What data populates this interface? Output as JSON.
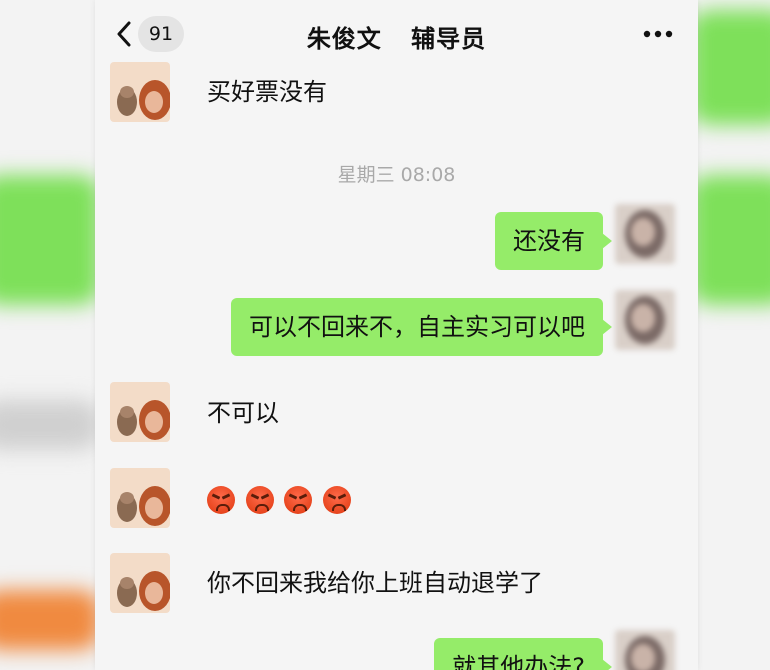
{
  "header": {
    "back_badge": "91",
    "title_name": "朱俊文",
    "title_role": "辅导员"
  },
  "messages": {
    "m1": "买好票没有",
    "timestamp": "星期三 08:08",
    "m2": "还没有",
    "m3": "可以不回来不，自主实习可以吧",
    "m4": "不可以",
    "m6": "你不回来我给你上班自动退学了",
    "m7": "就其他办法?"
  },
  "emoji_message": [
    "angry-face-icon",
    "angry-face-icon",
    "angry-face-icon",
    "angry-face-icon"
  ],
  "colors": {
    "outgoing_bubble": "#95ec69",
    "background": "#f5f5f5",
    "timestamp_text": "#a9a9a9"
  }
}
